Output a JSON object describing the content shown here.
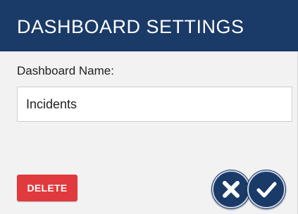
{
  "dialog": {
    "title": "DASHBOARD SETTINGS",
    "name_label": "Dashboard Name:",
    "name_value": "Incidents",
    "delete_label": "DELETE"
  },
  "icons": {
    "cancel": "close-icon",
    "confirm": "checkmark-icon"
  },
  "colors": {
    "header_bg": "#1a3a68",
    "delete_bg": "#e03a3e",
    "circle_button_bg": "#1a3a68"
  }
}
